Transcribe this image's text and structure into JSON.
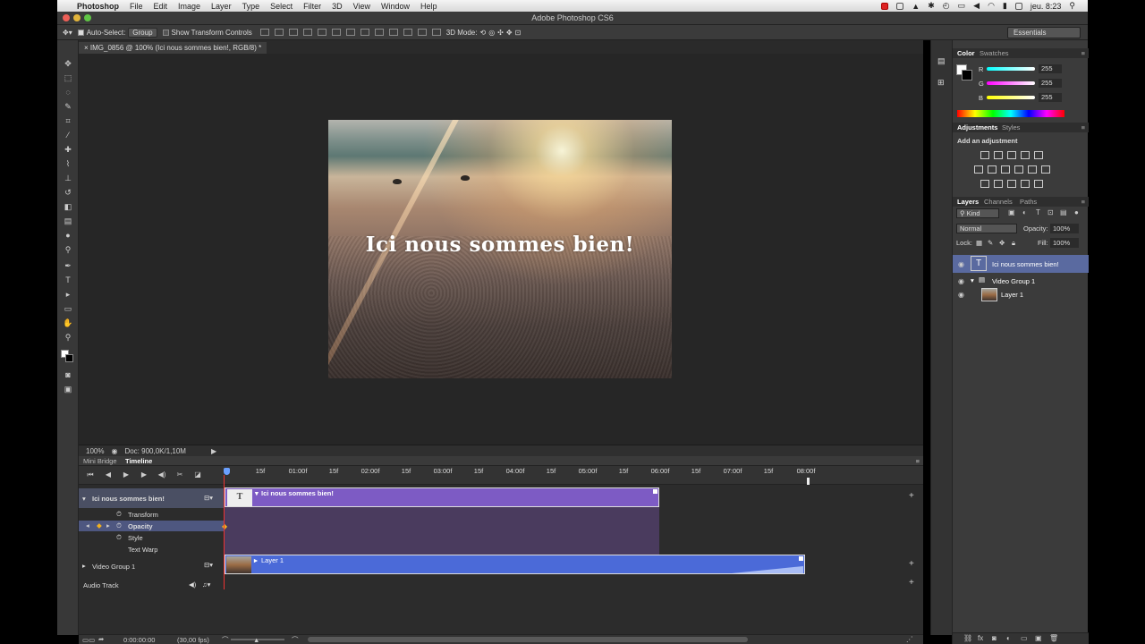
{
  "menubar": {
    "app_name": "Photoshop",
    "items": [
      "File",
      "Edit",
      "Image",
      "Layer",
      "Type",
      "Select",
      "Filter",
      "3D",
      "View",
      "Window",
      "Help"
    ],
    "clock": "jeu. 8:23"
  },
  "window": {
    "title": "Adobe Photoshop CS6"
  },
  "options_bar": {
    "auto_select_label": "Auto-Select:",
    "auto_select_value": "Group",
    "transform_label": "Show Transform Controls",
    "mode_label": "3D Mode:",
    "workspace": "Essentials"
  },
  "document": {
    "tab_label": "IMG_0856 @ 100% (Ici nous sommes bien!, RGB/8) *",
    "overlay_text": "Ici nous sommes bien!",
    "zoom": "100%",
    "doc_info": "Doc: 900,0K/1,10M"
  },
  "timeline": {
    "tabs": [
      "Mini Bridge",
      "Timeline"
    ],
    "active_tab": "Timeline",
    "ruler": [
      "15f",
      "01:00f",
      "15f",
      "02:00f",
      "15f",
      "03:00f",
      "15f",
      "04:00f",
      "15f",
      "05:00f",
      "15f",
      "06:00f",
      "15f",
      "07:00f",
      "15f",
      "08:00f"
    ],
    "tracks": {
      "text_track": "Ici nous sommes bien!",
      "properties": [
        "Transform",
        "Opacity",
        "Style",
        "Text Warp"
      ],
      "video_group": "Video Group 1",
      "audio_track": "Audio Track"
    },
    "clips": {
      "text_clip": "Ici nous sommes bien!",
      "layer_clip": "Layer 1"
    },
    "timecode": "0:00:00:00",
    "fps": "(30,00 fps)"
  },
  "color_panel": {
    "tabs": [
      "Color",
      "Swatches"
    ],
    "channels": [
      {
        "label": "R",
        "value": "255"
      },
      {
        "label": "G",
        "value": "255"
      },
      {
        "label": "B",
        "value": "255"
      }
    ]
  },
  "adjustments_panel": {
    "tabs": [
      "Adjustments",
      "Styles"
    ],
    "heading": "Add an adjustment"
  },
  "layers_panel": {
    "tabs": [
      "Layers",
      "Channels",
      "Paths"
    ],
    "filter_kind": "Kind",
    "blend_mode": "Normal",
    "opacity_label": "Opacity:",
    "opacity_value": "100%",
    "lock_label": "Lock:",
    "fill_label": "Fill:",
    "fill_value": "100%",
    "layers": [
      "Ici nous sommes bien!",
      "Video Group 1",
      "Layer 1"
    ]
  },
  "colors": {
    "text_clip": "#7d5bc4",
    "video_clip": "#4b6ad8",
    "selected_track": "#4e5780",
    "playhead": "#e33333"
  }
}
